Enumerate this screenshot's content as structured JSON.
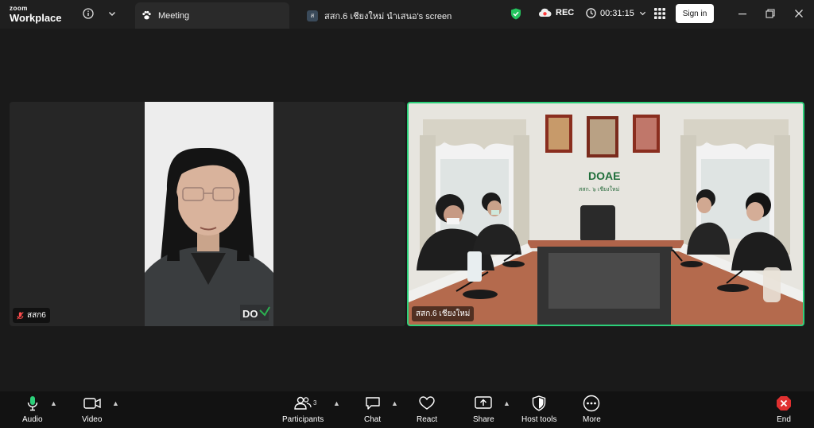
{
  "brand": {
    "line1": "zoom",
    "line2": "Workplace"
  },
  "tabs": {
    "meeting_label": "Meeting",
    "screen_chip": "ส",
    "screen_label": "สสก.6 เชียงใหม่ นำเสนอ's screen"
  },
  "status": {
    "rec_label": "REC",
    "timer": "00:31:15"
  },
  "signin_label": "Sign in",
  "participants": [
    {
      "name": "สสก6"
    },
    {
      "name": "สสก.6 เชียงใหม่"
    }
  ],
  "room": {
    "wall_logo": "DOAE",
    "wall_sub": "สสก. ๖ เชียงใหม่"
  },
  "toolbar": {
    "audio": "Audio",
    "video": "Video",
    "participants": "Participants",
    "participants_count": "3",
    "chat": "Chat",
    "react": "React",
    "share": "Share",
    "host_tools": "Host tools",
    "more": "More",
    "end": "End"
  },
  "colors": {
    "active_speaker": "#2cd07a",
    "end": "#e03030",
    "shield": "#24c45e",
    "rec": "#ff3b3b"
  }
}
